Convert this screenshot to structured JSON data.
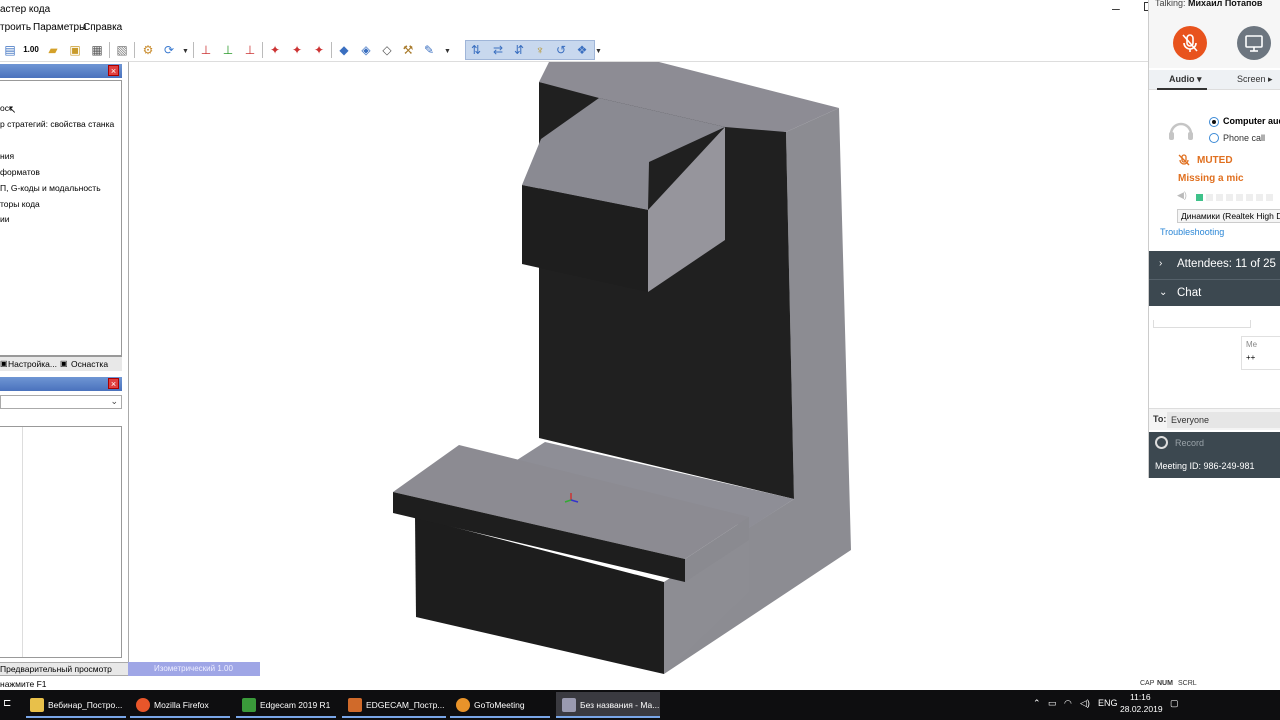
{
  "app": {
    "title": "астер кода",
    "menu": [
      "троить",
      "Параметры",
      "Справка"
    ],
    "left_top_panel": {
      "items": [
        "ост",
        "р стратегий: свойства станка",
        "ния",
        "форматов",
        "П, G-коды и модальность",
        "торы кода",
        "ии"
      ],
      "tabs": [
        "Настройка...",
        "Оснастка"
      ]
    },
    "preview_tab": "Предварительный просмотр",
    "view_tab": "Изометрический 1.00",
    "status_left": "нажмите F1",
    "status_indicators": [
      "CAP",
      "NUM",
      "SCRL"
    ],
    "toolbar_zoom_label": "1.00"
  },
  "meeting": {
    "talking_prefix": "Talking:",
    "talking_name": "Михаил Потапов",
    "tabs": [
      "Audio ▾",
      "Screen ▸"
    ],
    "audio_options": [
      "Computer audio",
      "Phone call"
    ],
    "muted": "MUTED",
    "missing_mic": "Missing a mic",
    "speaker": "Динамики (Realtek High Definition Audio)",
    "troubleshooting": "Troubleshooting",
    "attendees_label": "Attendees:",
    "attendees_count": "11 of 25",
    "chat_label": "Chat",
    "chat_partial_sender": "Me",
    "chat_partial_text": "++",
    "to_label": "To:",
    "to_value": "Everyone",
    "record": "Record",
    "meeting_id": "Meeting ID: 986-249-981",
    "colors": {
      "accent": "#e8531d",
      "dark": "#3c4850",
      "link": "#2a86d6",
      "muted": "#e07020"
    }
  },
  "taskbar": {
    "items": [
      "Вебинар_Постро...",
      "Mozilla Firefox",
      "Edgecam 2019 R1",
      "EDGECAM_Постр...",
      "GoToMeeting",
      "Без названия - Ма..."
    ],
    "lang": "ENG",
    "time": "11:16",
    "date": "28.02.2019"
  }
}
